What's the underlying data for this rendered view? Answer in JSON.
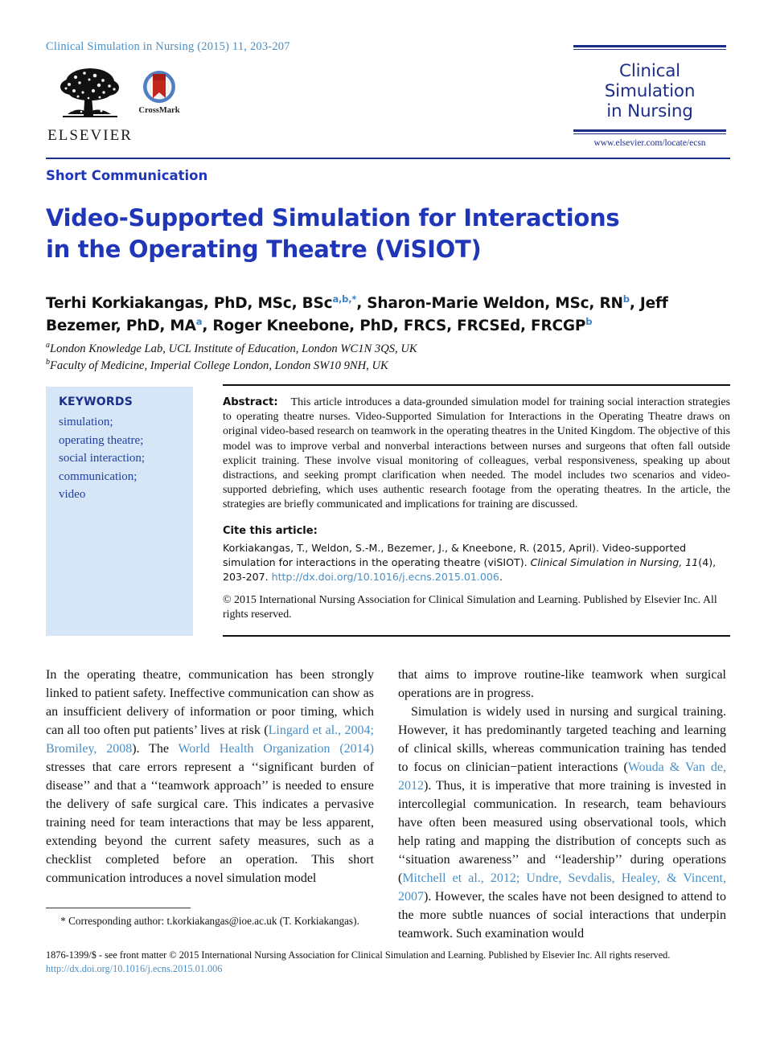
{
  "header": {
    "running_head": "Clinical Simulation in Nursing (2015) 11, 203-207",
    "publisher_name": "ELSEVIER",
    "crossmark_label": "CrossMark",
    "journal_title_line1": "Clinical Simulation",
    "journal_title_line2": "in Nursing",
    "journal_url": "www.elsevier.com/locate/ecsn"
  },
  "article": {
    "type": "Short Communication",
    "title_line1": "Video-Supported Simulation for Interactions",
    "title_line2": "in the Operating Theatre (ViSIOT)",
    "authors_line1_a": "Terhi Korkiakangas, PhD, MSc, BSc",
    "authors_sup1": "a,b,*",
    "authors_line1_b": ", Sharon-Marie Weldon, MSc, RN",
    "authors_sup2": "b",
    "authors_line1_c": ",",
    "authors_line2_a": "Jeff Bezemer, PhD, MA",
    "authors_sup3": "a",
    "authors_line2_b": ", Roger Kneebone, PhD, FRCS, FRCSEd, FRCGP",
    "authors_sup4": "b",
    "affiliation_a_sup": "a",
    "affiliation_a": "London Knowledge Lab, UCL Institute of Education, London WC1N 3QS, UK",
    "affiliation_b_sup": "b",
    "affiliation_b": "Faculty of Medicine, Imperial College London, London SW10 9NH, UK"
  },
  "keywords": {
    "heading": "KEYWORDS",
    "items": [
      "simulation;",
      "operating theatre;",
      "social interaction;",
      "communication;",
      "video"
    ]
  },
  "abstract": {
    "label": "Abstract:",
    "text": "This article introduces a data-grounded simulation model for training social interaction strategies to operating theatre nurses. Video-Supported Simulation for Interactions in the Operating Theatre draws on original video-based research on teamwork in the operating theatres in the United Kingdom. The objective of this model was to improve verbal and nonverbal interactions between nurses and surgeons that often fall outside explicit training. These involve visual monitoring of colleagues, verbal responsiveness, speaking up about distractions, and seeking prompt clarification when needed. The model includes two scenarios and video-supported debriefing, which uses authentic research footage from the operating theatres. In the article, the strategies are briefly communicated and implications for training are discussed."
  },
  "citation": {
    "heading": "Cite this article:",
    "text_part1": "Korkiakangas, T., Weldon, S.-M., Bezemer, J., & Kneebone, R. (2015, April). Video-supported simulation for interactions in the operating theatre (viSIOT). ",
    "journal_italic": "Clinical Simulation in Nursing, 11",
    "text_part2": "(4), 203-207. ",
    "doi": "http://dx.doi.org/10.1016/j.ecns.2015.01.006",
    "doi_period": "."
  },
  "copyright": {
    "text": "© 2015 International Nursing Association for Clinical Simulation and Learning. Published by Elsevier Inc. All rights reserved."
  },
  "body": {
    "left_col": {
      "p1_seg1": "In the operating theatre, communication has been strongly linked to patient safety. Ineffective communication can show as an insufficient delivery of information or poor timing, which can all too often put patients’ lives at risk (",
      "p1_ref1": "Lingard et al., 2004; Bromiley, 2008",
      "p1_seg2": "). The ",
      "p1_ref2": "World Health Organization (2014)",
      "p1_seg3": " stresses that care errors represent a ‘‘significant burden of disease’’ and that a ‘‘teamwork approach’’ is needed to ensure the delivery of safe surgical care. This indicates a pervasive training need for team interactions that may be less apparent, extending beyond the current safety measures, such as a checklist completed before an operation. This short communication introduces a novel simulation model"
    },
    "right_col": {
      "p1": "that aims to improve routine-like teamwork when surgical operations are in progress.",
      "p2_seg1": "Simulation is widely used in nursing and surgical training. However, it has predominantly targeted teaching and learning of clinical skills, whereas communication training has tended to focus on clinician−patient interactions (",
      "p2_ref1": "Wouda & Van de, 2012",
      "p2_seg2": "). Thus, it is imperative that more training is invested in intercollegial communication. In research, team behaviours have often been measured using observational tools, which help rating and mapping the distribution of concepts such as ‘‘situation awareness’’ and ‘‘leadership’’ during operations (",
      "p2_ref2": "Mitchell et al., 2012; Undre, Sevdalis, Healey, & Vincent, 2007",
      "p2_seg3": "). However, the scales have not been designed to attend to the more subtle nuances of social interactions that underpin teamwork. Such examination would"
    }
  },
  "footnote": {
    "marker": "* Corresponding author:",
    "email": "t.korkiakangas@ioe.ac.uk",
    "suffix": " (T. Korkiakangas)."
  },
  "footer": {
    "line1": "1876-1399/$ - see front matter © 2015 International Nursing Association for Clinical Simulation and Learning. Published by Elsevier Inc. All rights reserved.",
    "doi": "http://dx.doi.org/10.1016/j.ecns.2015.01.006"
  },
  "colors": {
    "journal_blue": "#1b2f8a",
    "title_blue": "#2036b8",
    "link_blue": "#4a8fc4",
    "keyword_panel": "#d6e6f7"
  }
}
